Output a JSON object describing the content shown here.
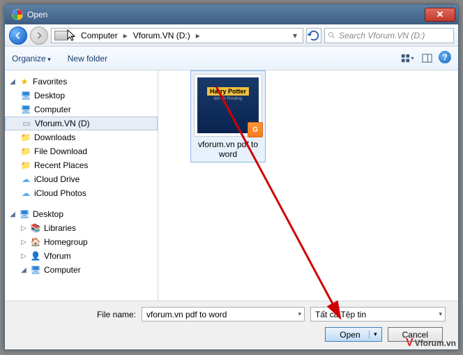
{
  "window": {
    "title": "Open"
  },
  "nav": {
    "breadcrumb": [
      "Computer",
      "Vforum.VN (D:)"
    ],
    "search_placeholder": "Search Vforum.VN (D:)"
  },
  "toolbar": {
    "organize": "Organize",
    "new_folder": "New folder"
  },
  "tree": {
    "favorites": {
      "label": "Favorites",
      "items": [
        {
          "label": "Desktop",
          "icon": "monitor"
        },
        {
          "label": "Computer",
          "icon": "monitor"
        },
        {
          "label": "Vforum.VN (D)",
          "icon": "drive",
          "selected": true
        },
        {
          "label": "Downloads",
          "icon": "folder"
        },
        {
          "label": "File Download",
          "icon": "folder"
        },
        {
          "label": "Recent Places",
          "icon": "folder"
        },
        {
          "label": "iCloud Drive",
          "icon": "cloud"
        },
        {
          "label": "iCloud Photos",
          "icon": "cloud"
        }
      ]
    },
    "desktop": {
      "label": "Desktop",
      "items": [
        {
          "label": "Libraries",
          "icon": "lib"
        },
        {
          "label": "Homegroup",
          "icon": "home"
        },
        {
          "label": "Vforum",
          "icon": "user"
        },
        {
          "label": "Computer",
          "icon": "monitor"
        }
      ]
    }
  },
  "content": {
    "item": {
      "name": "vforum.vn pdf to word",
      "thumb_title": "Harry Potter"
    }
  },
  "footer": {
    "file_name_label": "File name:",
    "file_name_value": "vforum.vn pdf to word",
    "filter_value": "Tất cả Tệp tin",
    "open_label": "Open",
    "cancel_label": "Cancel"
  },
  "watermark": "Vforum.vn"
}
